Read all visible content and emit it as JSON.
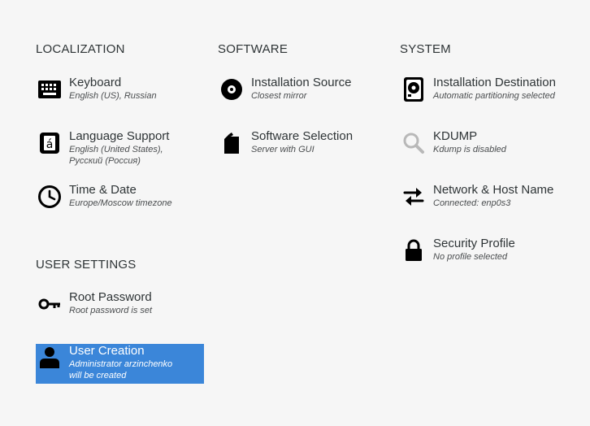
{
  "localization": {
    "header": "LOCALIZATION",
    "keyboard": {
      "title": "Keyboard",
      "status": "English (US), Russian"
    },
    "language": {
      "title": "Language Support",
      "status_line1": "English (United States),",
      "status_line2": "Русский (Россия)"
    },
    "time_date": {
      "title": "Time & Date",
      "status": "Europe/Moscow timezone"
    }
  },
  "software": {
    "header": "SOFTWARE",
    "installation_source": {
      "title": "Installation Source",
      "status": "Closest mirror"
    },
    "software_selection": {
      "title": "Software Selection",
      "status": "Server with GUI"
    }
  },
  "system": {
    "header": "SYSTEM",
    "installation_destination": {
      "title": "Installation Destination",
      "status": "Automatic partitioning selected"
    },
    "kdump": {
      "title": "KDUMP",
      "status": "Kdump is disabled"
    },
    "network": {
      "title": "Network & Host Name",
      "status": "Connected: enp0s3"
    },
    "security": {
      "title": "Security Profile",
      "status": "No profile selected"
    }
  },
  "user_settings": {
    "header": "USER SETTINGS",
    "root_password": {
      "title": "Root Password",
      "status": "Root password is set"
    },
    "user_creation": {
      "title": "User Creation",
      "status_line1": "Administrator arzinchenko",
      "status_line2": "will be created"
    }
  },
  "colors": {
    "selected_background": "#3b86d9",
    "icon": "#000000",
    "icon_disabled": "#b8b8b8",
    "page_background": "#f6f6f6"
  }
}
